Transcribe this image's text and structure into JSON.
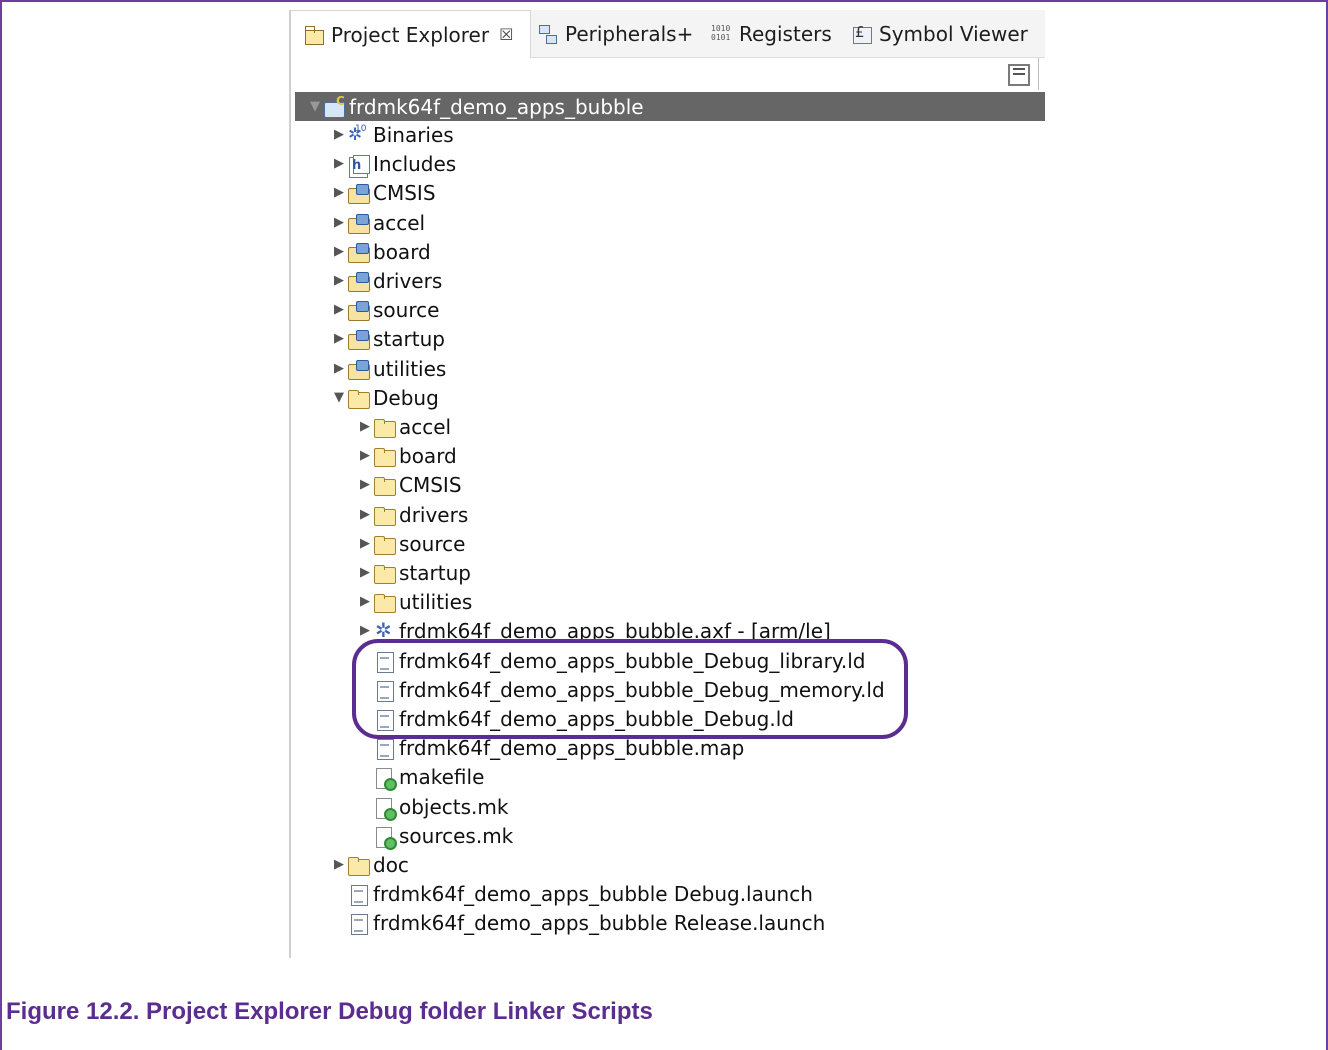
{
  "tabs": [
    {
      "label": "Project Explorer",
      "icon": "project-explorer-icon",
      "active": true,
      "close": "☒"
    },
    {
      "label": "Peripherals+",
      "icon": "peripherals-icon"
    },
    {
      "label": "Registers",
      "icon": "registers-icon"
    },
    {
      "label": "Symbol Viewer",
      "icon": "symbol-viewer-icon"
    }
  ],
  "toolbar": {
    "collapse_icon": "collapse-all-icon"
  },
  "tree": {
    "project": "frdmk64f_demo_apps_bubble",
    "items": [
      {
        "label": "Binaries",
        "icon": "binaries-icon"
      },
      {
        "label": "Includes",
        "icon": "includes-icon"
      },
      {
        "label": "CMSIS",
        "icon": "source-folder-icon"
      },
      {
        "label": "accel",
        "icon": "source-folder-icon"
      },
      {
        "label": "board",
        "icon": "source-folder-icon"
      },
      {
        "label": "drivers",
        "icon": "source-folder-icon"
      },
      {
        "label": "source",
        "icon": "source-folder-icon"
      },
      {
        "label": "startup",
        "icon": "source-folder-icon"
      },
      {
        "label": "utilities",
        "icon": "source-folder-icon"
      }
    ],
    "debug": {
      "label": "Debug",
      "children": [
        {
          "label": "accel",
          "icon": "folder-icon"
        },
        {
          "label": "board",
          "icon": "folder-icon"
        },
        {
          "label": "CMSIS",
          "icon": "folder-icon"
        },
        {
          "label": "drivers",
          "icon": "folder-icon"
        },
        {
          "label": "source",
          "icon": "folder-icon"
        },
        {
          "label": "startup",
          "icon": "folder-icon"
        },
        {
          "label": "utilities",
          "icon": "folder-icon"
        },
        {
          "label": "frdmk64f_demo_apps_bubble.axf - [arm/le]",
          "icon": "binary-file-icon"
        },
        {
          "label": "frdmk64f_demo_apps_bubble_Debug_library.ld",
          "icon": "file-icon"
        },
        {
          "label": "frdmk64f_demo_apps_bubble_Debug_memory.ld",
          "icon": "file-icon"
        },
        {
          "label": "frdmk64f_demo_apps_bubble_Debug.ld",
          "icon": "file-icon"
        },
        {
          "label": "frdmk64f_demo_apps_bubble.map",
          "icon": "file-icon"
        },
        {
          "label": "makefile",
          "icon": "makefile-icon"
        },
        {
          "label": "objects.mk",
          "icon": "makefile-icon"
        },
        {
          "label": "sources.mk",
          "icon": "makefile-icon"
        }
      ]
    },
    "doc": {
      "label": "doc",
      "icon": "folder-icon"
    },
    "launches": [
      {
        "label": "frdmk64f_demo_apps_bubble Debug.launch",
        "icon": "file-icon"
      },
      {
        "label": "frdmk64f_demo_apps_bubble Release.launch",
        "icon": "file-icon"
      }
    ]
  },
  "caption": "Figure 12.2. Project Explorer Debug folder Linker Scripts",
  "colors": {
    "highlight": "#5b2d91",
    "selected_row": "#666666",
    "caption": "#5b2d91"
  }
}
